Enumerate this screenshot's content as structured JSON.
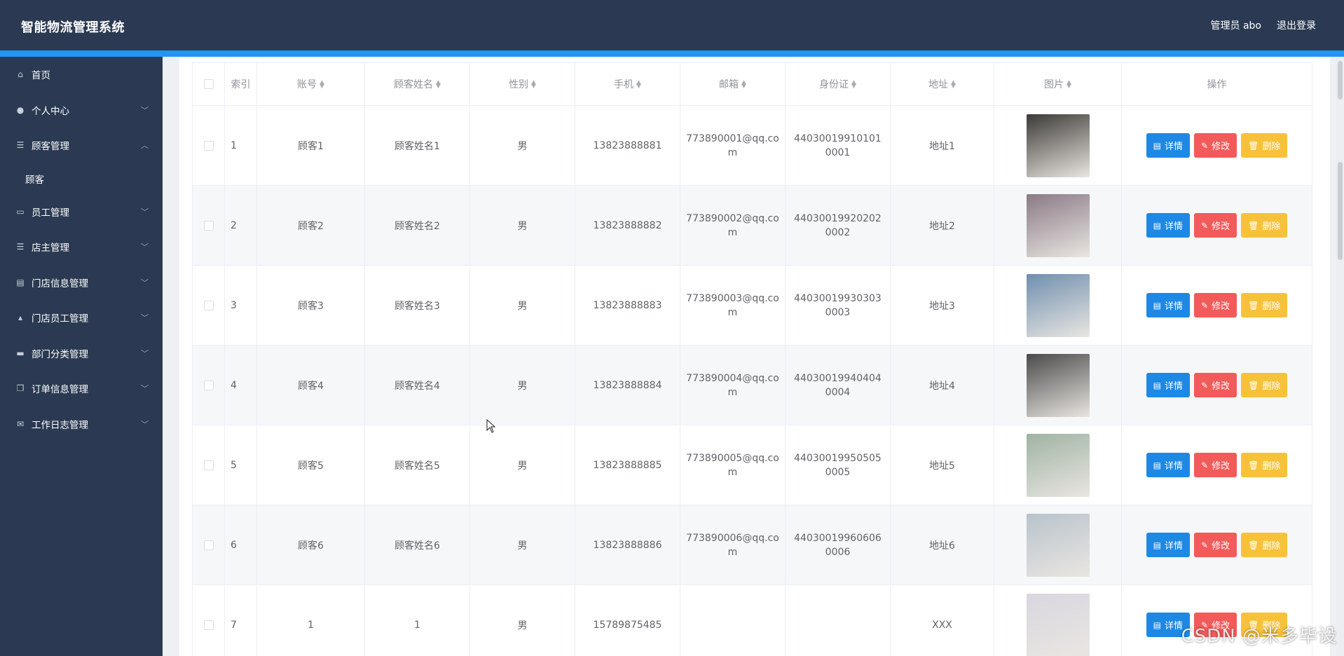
{
  "app": {
    "title": "智能物流管理系统",
    "user_label": "管理员 abo",
    "logout_label": "退出登录"
  },
  "sidebar": {
    "items": [
      {
        "label": "首页",
        "icon": "home-icon"
      },
      {
        "label": "个人中心",
        "icon": "user-icon"
      },
      {
        "label": "顾客管理",
        "icon": "menu-icon",
        "expanded": true,
        "sub": [
          "顾客"
        ]
      },
      {
        "label": "员工管理",
        "icon": "chat-icon"
      },
      {
        "label": "店主管理",
        "icon": "menu-icon"
      },
      {
        "label": "门店信息管理",
        "icon": "briefcase-icon"
      },
      {
        "label": "门店员工管理",
        "icon": "thumb-icon"
      },
      {
        "label": "部门分类管理",
        "icon": "ticket-icon"
      },
      {
        "label": "订单信息管理",
        "icon": "copy-icon"
      },
      {
        "label": "工作日志管理",
        "icon": "mail-icon"
      }
    ]
  },
  "table": {
    "headers": [
      "索引",
      "账号",
      "顾客姓名",
      "性别",
      "手机",
      "邮箱",
      "身份证",
      "地址",
      "图片",
      "操作"
    ],
    "actions": {
      "detail": "详情",
      "edit": "修改",
      "delete": "删除"
    },
    "rows": [
      {
        "index": "1",
        "account": "顾客1",
        "name": "顾客姓名1",
        "gender": "男",
        "phone": "13823888881",
        "email": "773890001@qq.com",
        "idcard": "440300199101010001",
        "address": "地址1",
        "avatar": "#3c3a36"
      },
      {
        "index": "2",
        "account": "顾客2",
        "name": "顾客姓名2",
        "gender": "男",
        "phone": "13823888882",
        "email": "773890002@qq.com",
        "idcard": "440300199202020002",
        "address": "地址2",
        "avatar": "#8a7a86"
      },
      {
        "index": "3",
        "account": "顾客3",
        "name": "顾客姓名3",
        "gender": "男",
        "phone": "13823888883",
        "email": "773890003@qq.com",
        "idcard": "440300199303030003",
        "address": "地址3",
        "avatar": "#6f8fb0"
      },
      {
        "index": "4",
        "account": "顾客4",
        "name": "顾客姓名4",
        "gender": "男",
        "phone": "13823888884",
        "email": "773890004@qq.com",
        "idcard": "440300199404040004",
        "address": "地址4",
        "avatar": "#4a4a4a"
      },
      {
        "index": "5",
        "account": "顾客5",
        "name": "顾客姓名5",
        "gender": "男",
        "phone": "13823888885",
        "email": "773890005@qq.com",
        "idcard": "440300199505050005",
        "address": "地址5",
        "avatar": "#9fb3a3"
      },
      {
        "index": "6",
        "account": "顾客6",
        "name": "顾客姓名6",
        "gender": "男",
        "phone": "13823888886",
        "email": "773890006@qq.com",
        "idcard": "440300199606060006",
        "address": "地址6",
        "avatar": "#b9c3cc"
      },
      {
        "index": "7",
        "account": "1",
        "name": "1",
        "gender": "男",
        "phone": "15789875485",
        "email": "",
        "idcard": "",
        "address": "XXX",
        "avatar": "#d9d6e0"
      }
    ]
  },
  "watermark": "CSDN @米多毕设",
  "colors": {
    "header": "#2b3a52",
    "accent": "#2196f3",
    "blue": "#1e88e5",
    "red": "#f35a5a",
    "yellow": "#f7c23a"
  }
}
